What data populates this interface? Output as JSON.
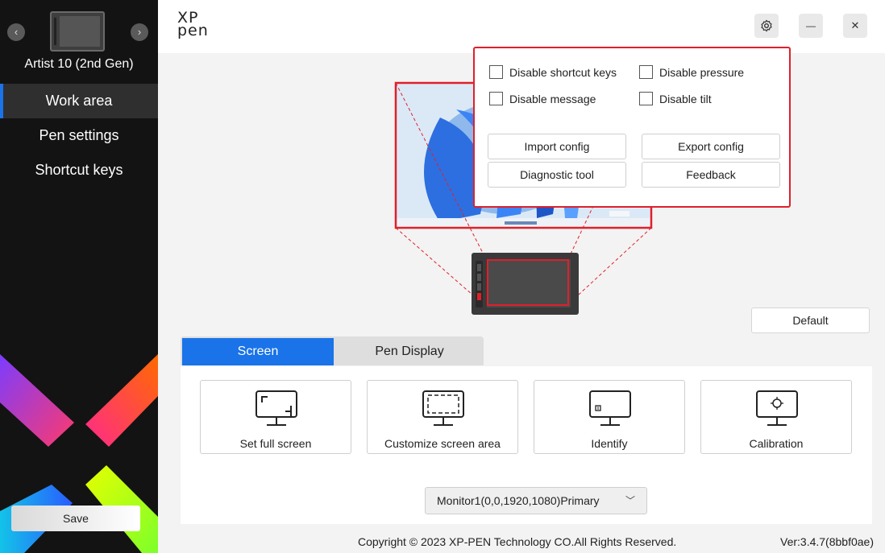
{
  "sidebar": {
    "prev_icon": "‹",
    "next_icon": "›",
    "device_name": "Artist 10 (2nd Gen)",
    "items": [
      {
        "label": "Work area",
        "active": true
      },
      {
        "label": "Pen settings",
        "active": false
      },
      {
        "label": "Shortcut keys",
        "active": false
      }
    ],
    "save_label": "Save"
  },
  "header": {
    "logo_line1": "XP",
    "logo_line2": "pen",
    "settings_icon": "gear-icon",
    "minimize_glyph": "—",
    "close_glyph": "✕"
  },
  "popup": {
    "checkboxes": [
      {
        "label": "Disable shortcut keys",
        "checked": false
      },
      {
        "label": "Disable pressure",
        "checked": false
      },
      {
        "label": "Disable message",
        "checked": false
      },
      {
        "label": "Disable tilt",
        "checked": false
      }
    ],
    "buttons": [
      "Import config",
      "Export config",
      "Diagnostic tool",
      "Feedback"
    ]
  },
  "main": {
    "default_label": "Default",
    "tabs": [
      {
        "label": "Screen",
        "active": true
      },
      {
        "label": "Pen Display",
        "active": false
      }
    ],
    "cards": [
      {
        "label": "Set full screen",
        "icon": "full-screen-monitor-icon"
      },
      {
        "label": "Customize screen area",
        "icon": "custom-area-monitor-icon"
      },
      {
        "label": "Identify",
        "icon": "identify-monitor-icon"
      },
      {
        "label": "Calibration",
        "icon": "calibration-monitor-icon"
      }
    ],
    "monitor_select": {
      "value": "Monitor1(0,0,1920,1080)Primary",
      "chevron": "﹀"
    }
  },
  "footer": {
    "copyright": "Copyright © 2023  XP-PEN Technology CO.All Rights Reserved.",
    "version": "Ver:3.4.7(8bbf0ae)"
  },
  "colors": {
    "accent": "#1a73e8",
    "highlight": "#e0202a",
    "sidebar_bg": "#131313"
  }
}
